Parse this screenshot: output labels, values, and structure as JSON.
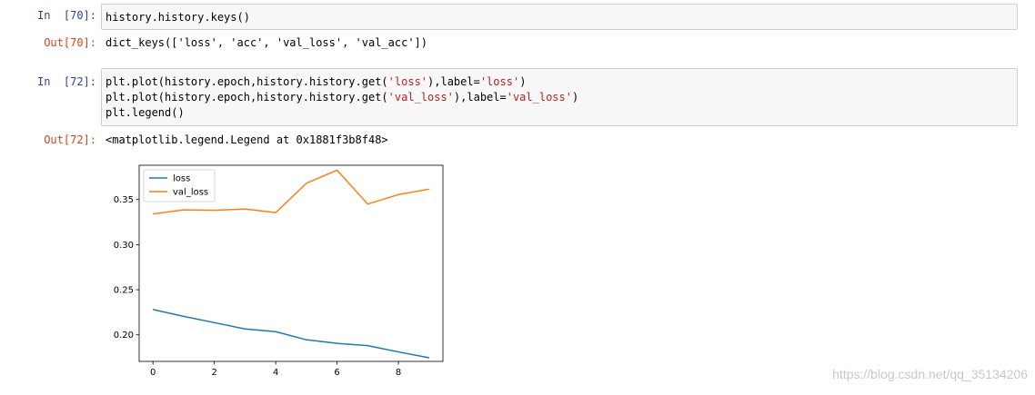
{
  "cells": [
    {
      "in_prompt": "In  [70]:",
      "code": [
        [
          {
            "t": "history.history.keys()"
          }
        ]
      ],
      "out_prompt": "Out[70]:",
      "output": "dict_keys(['loss', 'acc', 'val_loss', 'val_acc'])"
    },
    {
      "in_prompt": "In  [72]:",
      "code": [
        [
          {
            "t": "plt.plot(history.epoch,history.history.get("
          },
          {
            "t": "'loss'",
            "s": 1
          },
          {
            "t": "),label="
          },
          {
            "t": "'loss'",
            "s": 1
          },
          {
            "t": ")"
          }
        ],
        [
          {
            "t": "plt.plot(history.epoch,history.history.get("
          },
          {
            "t": "'val_loss'",
            "s": 1
          },
          {
            "t": "),label="
          },
          {
            "t": "'val_loss'",
            "s": 1
          },
          {
            "t": ")"
          }
        ],
        [
          {
            "t": "plt.legend()"
          }
        ]
      ],
      "out_prompt": "Out[72]:",
      "output": "<matplotlib.legend.Legend at 0x1881f3b8f48>"
    }
  ],
  "chart_data": {
    "type": "line",
    "x": [
      0,
      1,
      2,
      3,
      4,
      5,
      6,
      7,
      8,
      9
    ],
    "xlim": [
      -0.45,
      9.45
    ],
    "ylim": [
      0.1705,
      0.388
    ],
    "xticks": [
      0,
      2,
      4,
      6,
      8
    ],
    "yticks": [
      0.2,
      0.25,
      0.3,
      0.35
    ],
    "xtick_labels": [
      "0",
      "2",
      "4",
      "6",
      "8"
    ],
    "ytick_labels": [
      "0.20",
      "0.25",
      "0.30",
      "0.35"
    ],
    "legend_position": "top-left",
    "grid": false,
    "series": [
      {
        "name": "loss",
        "color": "#1f77b4",
        "values": [
          0.228,
          0.2205,
          0.2135,
          0.2065,
          0.2035,
          0.1945,
          0.1905,
          0.188,
          0.181,
          0.1745
        ]
      },
      {
        "name": "val_loss",
        "color": "#ff7f0e",
        "values": [
          0.334,
          0.3385,
          0.338,
          0.3395,
          0.3355,
          0.368,
          0.3825,
          0.345,
          0.3555,
          0.3615
        ]
      }
    ]
  },
  "watermark": "https://blog.csdn.net/qq_35134206"
}
